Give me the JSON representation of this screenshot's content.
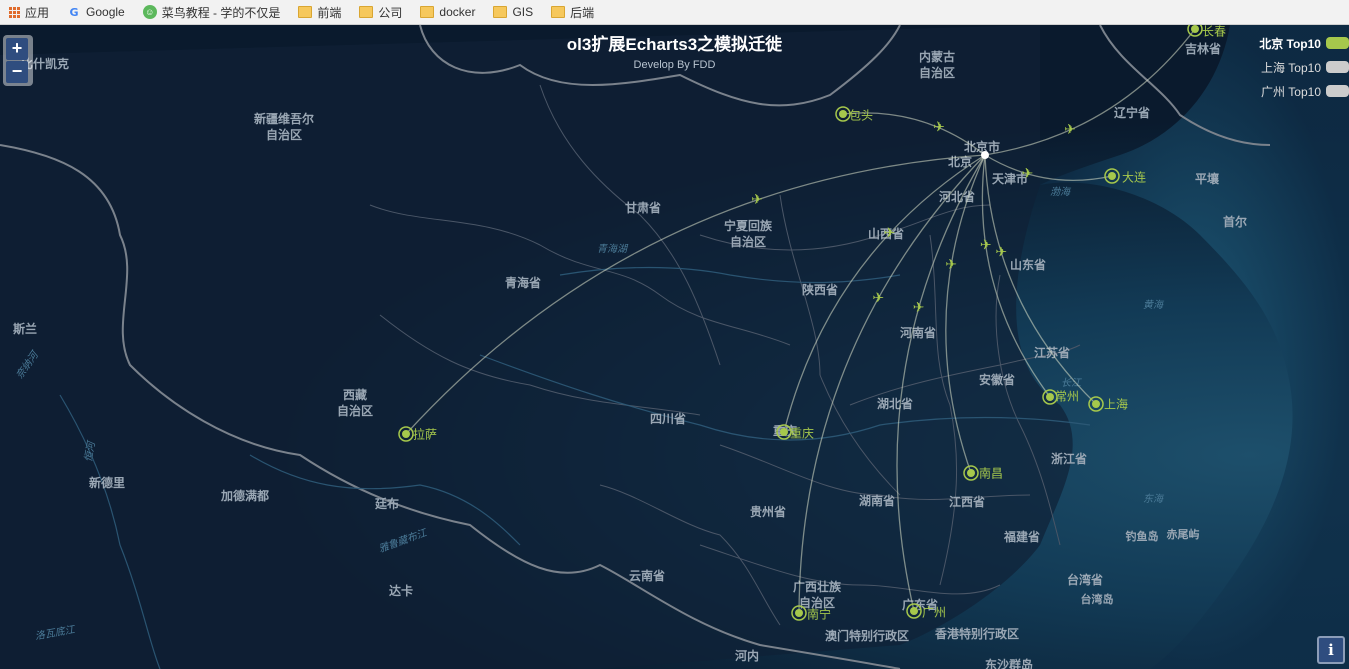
{
  "bookmarks": {
    "apps": "应用",
    "items": [
      {
        "label": "Google",
        "icon": "google-icon"
      },
      {
        "label": "菜鸟教程 - 学的不仅是",
        "icon": "runoob-icon"
      },
      {
        "label": "前端",
        "icon": "folder-icon"
      },
      {
        "label": "公司",
        "icon": "folder-icon"
      },
      {
        "label": "docker",
        "icon": "folder-icon"
      },
      {
        "label": "GIS",
        "icon": "folder-icon"
      },
      {
        "label": "后端",
        "icon": "folder-icon"
      }
    ]
  },
  "map": {
    "title": "ol3扩展Echarts3之模拟迁徙",
    "subtitle": "Develop By FDD",
    "zoom_in": "+",
    "zoom_out": "−",
    "info": "i",
    "legend": [
      {
        "label": "北京 Top10",
        "active": true
      },
      {
        "label": "上海 Top10",
        "active": false
      },
      {
        "label": "广州 Top10",
        "active": false
      }
    ],
    "regions": [
      "内蒙古\n自治区",
      "新疆维吾尔\n自治区",
      "甘肃省",
      "宁夏回族\n自治区",
      "青海省",
      "西藏\n自治区",
      "四川省",
      "陕西省",
      "山西省",
      "河北省",
      "北京市",
      "天津市",
      "辽宁省",
      "吉林省",
      "山东省",
      "河南省",
      "湖北省",
      "安徽省",
      "江苏省",
      "浙江省",
      "江西省",
      "湖南省",
      "贵州省",
      "云南省",
      "福建省",
      "广西壮族\n自治区",
      "广东省",
      "台湾省",
      "澳门特别行政区",
      "香港特别行政区",
      "重庆",
      "平壤",
      "首尔",
      "比什凯克",
      "新德里",
      "加德满都",
      "廷布",
      "达卡",
      "河内",
      "东沙群岛",
      "钓鱼岛",
      "赤尾屿",
      "台湾岛",
      "斯兰",
      "北京"
    ],
    "seas": [
      "渤海",
      "黄海",
      "东海",
      "青海湖",
      "长江"
    ],
    "rivers": [
      "雅鲁藏布江",
      "恒河",
      "奈纳河",
      "洛瓦底江"
    ],
    "cities": [
      "长春",
      "包头",
      "大连",
      "拉萨",
      "重庆",
      "常州",
      "上海",
      "南昌",
      "南宁",
      "广州"
    ],
    "colors": {
      "accent": "#a6c84c",
      "route": "#ffffff",
      "ocean": "#0a1a2d",
      "border": "#6f7a87"
    }
  }
}
